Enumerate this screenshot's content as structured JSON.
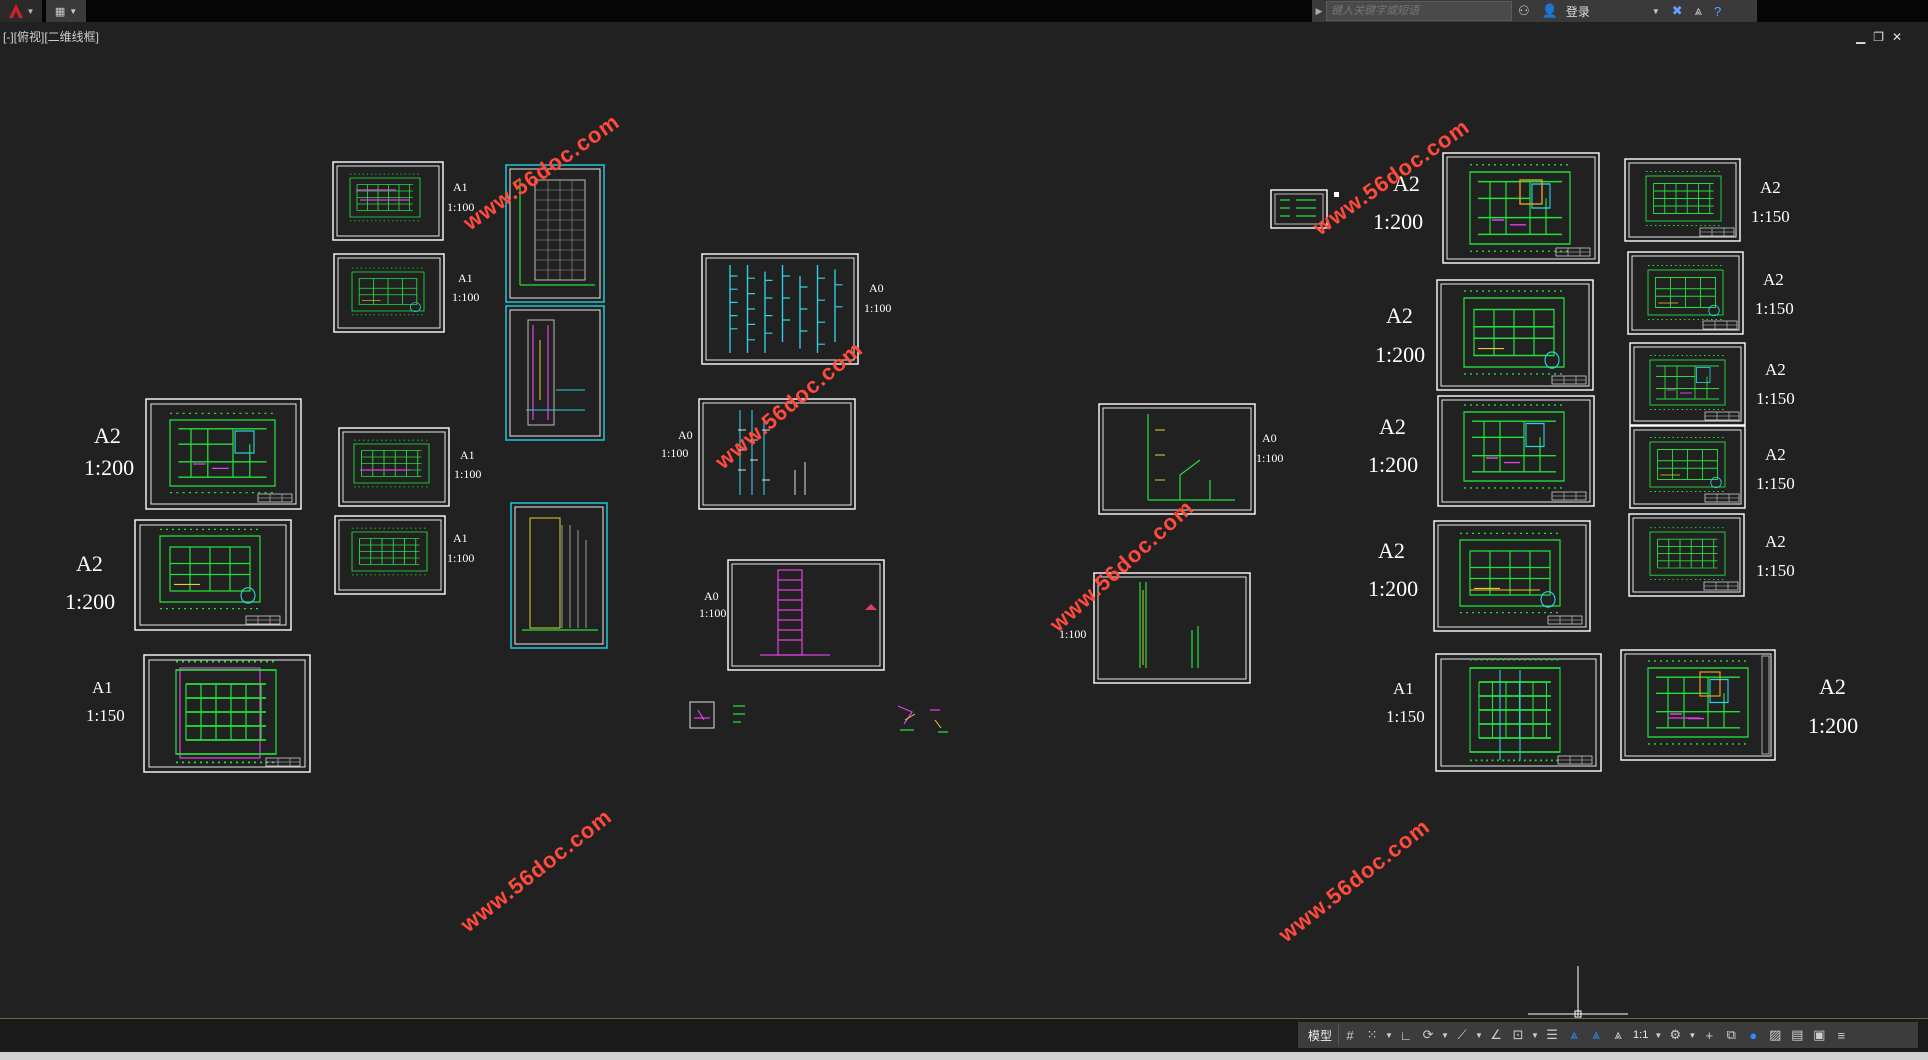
{
  "titlebar": {
    "search_placeholder": "键入关键字或短语",
    "login_label": "登录"
  },
  "viewport": {
    "label": "[-][俯视][二维线框]"
  },
  "watermark_text": "www.56doc.com",
  "statusbar": {
    "model_tab": "模型",
    "scale": "1:1"
  },
  "sheets": {
    "left_col": [
      {
        "size": "A2",
        "scale": "1:200"
      },
      {
        "size": "A2",
        "scale": "1:200"
      },
      {
        "size": "A1",
        "scale": "1:150"
      }
    ],
    "left_small": [
      {
        "size": "A1",
        "scale": "1:100"
      },
      {
        "size": "A1",
        "scale": "1:100"
      },
      {
        "size": "A1",
        "scale": "1:100"
      },
      {
        "size": "A1",
        "scale": "1:100"
      }
    ],
    "center": [
      {
        "size": "A0",
        "scale": "1:100"
      },
      {
        "size": "A0",
        "scale": "1:100"
      },
      {
        "size": "A0",
        "scale": "1:100"
      }
    ],
    "center_right": [
      {
        "size": "A0",
        "scale": "1:100"
      },
      {
        "size": "",
        "scale": "1:100"
      }
    ],
    "right_mid": [
      {
        "size": "A2",
        "scale": "1:200"
      },
      {
        "size": "A2",
        "scale": "1:200"
      },
      {
        "size": "A2",
        "scale": "1:200"
      },
      {
        "size": "A2",
        "scale": "1:200"
      },
      {
        "size": "A1",
        "scale": "1:150"
      }
    ],
    "right_far": [
      {
        "size": "A2",
        "scale": "1:150"
      },
      {
        "size": "A2",
        "scale": "1:150"
      },
      {
        "size": "A2",
        "scale": "1:150"
      },
      {
        "size": "A2",
        "scale": "1:150"
      },
      {
        "size": "A2",
        "scale": "1:150"
      },
      {
        "size": "A2",
        "scale": "1:200"
      }
    ]
  },
  "colors": {
    "canvas_bg": "#212121",
    "plan_green": "#22e03a",
    "frame_white": "#ffffff",
    "accent_cyan": "#1ec8d8",
    "watermark_red": "#ff4a3c"
  }
}
